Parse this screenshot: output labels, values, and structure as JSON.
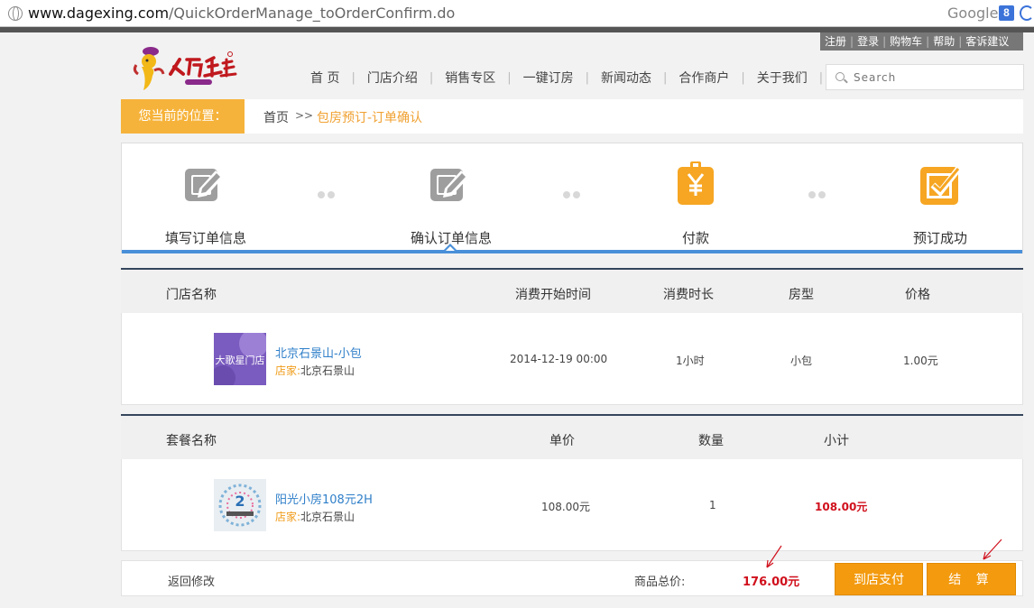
{
  "browser": {
    "url_host": "www.dagexing.com",
    "url_path": "/QuickOrderManage_toOrderConfirm.do",
    "search_engine": "Google"
  },
  "top_links": [
    "注册",
    "登录",
    "购物车",
    "帮助",
    "客诉建议"
  ],
  "nav": {
    "items": [
      "首 页",
      "门店介绍",
      "销售专区",
      "一键订房",
      "新闻动态",
      "合作商户",
      "关于我们"
    ],
    "search_placeholder": "Search"
  },
  "breadcrumb": {
    "label": "您当前的位置：",
    "home": "首页",
    "separator": ">>",
    "current": "包房预订-订单确认"
  },
  "steps": [
    {
      "label": "填写订单信息",
      "icon": "edit-icon",
      "state": "done"
    },
    {
      "label": "确认订单信息",
      "icon": "edit-icon",
      "state": "current"
    },
    {
      "label": "付款",
      "icon": "payment-icon",
      "state": "pending"
    },
    {
      "label": "预订成功",
      "icon": "check-icon",
      "state": "pending"
    }
  ],
  "room_table": {
    "headers": {
      "store": "门店名称",
      "start": "消费开始时间",
      "duration": "消费时长",
      "type": "房型",
      "price": "价格"
    },
    "rows": [
      {
        "thumb_text": "大歌星门店",
        "name": "北京石景山-小包",
        "shop_label": "店家:",
        "shop_value": "北京石景山",
        "start": "2014-12-19 00:00",
        "duration": "1小时",
        "type": "小包",
        "price": "1.00元"
      }
    ]
  },
  "package_table": {
    "headers": {
      "name": "套餐名称",
      "unit": "单价",
      "qty": "数量",
      "subtotal": "小计"
    },
    "rows": [
      {
        "name": "阳光小房108元2H",
        "shop_label": "店家:",
        "shop_value": "北京石景山",
        "unit": "108.00元",
        "qty": "1",
        "subtotal": "108.00元"
      }
    ]
  },
  "footer": {
    "back_label": "返回修改",
    "total_label": "商品总价:",
    "total_value": "176.00元",
    "pay_store_label": "到店支付",
    "settle_label": "结 算"
  },
  "colors": {
    "accent_orange": "#f39a0e",
    "breadcrumb_orange": "#f6b33b",
    "link_blue": "#2f7fc9",
    "price_red": "#d0101c",
    "step_line_blue": "#4a90d9"
  }
}
